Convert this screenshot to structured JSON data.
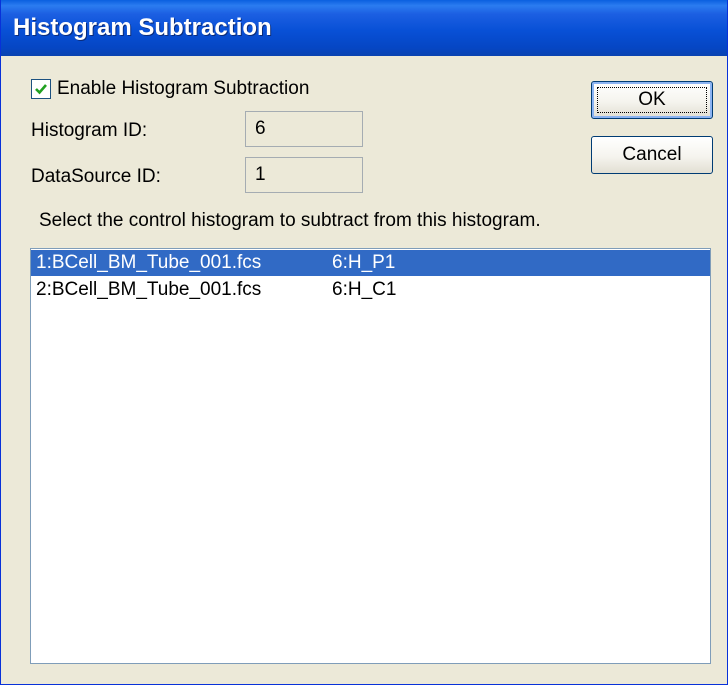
{
  "window": {
    "title": "Histogram Subtraction"
  },
  "enable_checkbox": {
    "label": "Enable Histogram Subtraction",
    "checked": true
  },
  "fields": {
    "histogram_id": {
      "label": "Histogram ID:",
      "value": "6"
    },
    "datasource_id": {
      "label": "DataSource ID:",
      "value": "1"
    }
  },
  "buttons": {
    "ok": "OK",
    "cancel": "Cancel"
  },
  "instruction": "Select the control histogram to subtract from this histogram.",
  "histogram_list": {
    "items": [
      {
        "file": "1:BCell_BM_Tube_001.fcs",
        "histogram": "6:H_P1",
        "selected": true
      },
      {
        "file": "2:BCell_BM_Tube_001.fcs",
        "histogram": "6:H_C1",
        "selected": false
      }
    ]
  },
  "colors": {
    "selection": "#316ac5",
    "titlebar": "#0a50d6",
    "dialog_bg": "#ece9d8",
    "checkmark": "#21a121"
  }
}
